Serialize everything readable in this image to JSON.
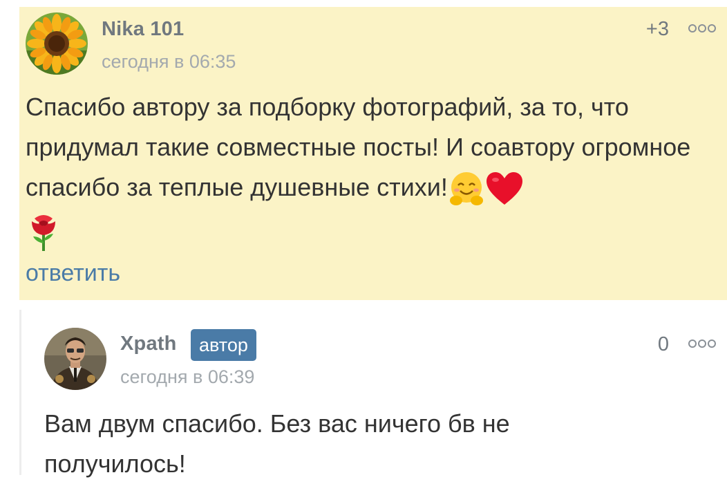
{
  "comments": [
    {
      "author": "Nika 101",
      "time": "сегодня в 06:35",
      "rating": "+3",
      "text": "Спасибо автору за подборку фотографий, за то, что придумал такие совместные посты! И соавтору огромное спасибо за теплые душевные стихи!",
      "emojis": [
        "hugging-face-icon",
        "red-heart-icon",
        "rose-icon"
      ],
      "reply_label": "ответить",
      "avatar": "sunflower-avatar",
      "background": "#fbf3c6"
    },
    {
      "author": "Xpath",
      "badge": "автор",
      "time": "сегодня в 06:39",
      "rating": "0",
      "text_line1": "Вам двум спасибо. Без вас ничего бв не",
      "text_line2": "получилось!",
      "avatar": "steampunk-man-avatar"
    }
  ],
  "colors": {
    "accent": "#4a7ba7",
    "author": "#70787f",
    "muted": "#a3a9ae",
    "text": "#333333"
  }
}
